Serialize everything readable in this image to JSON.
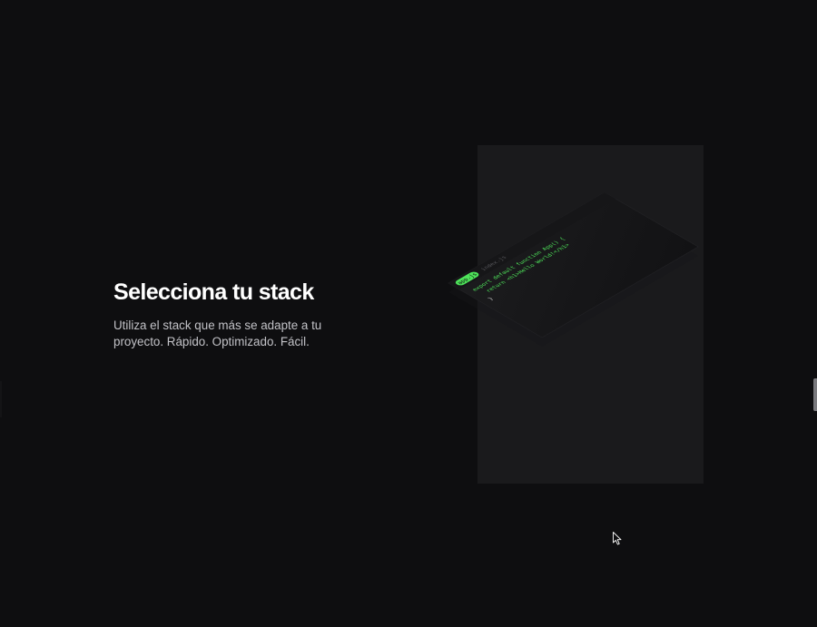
{
  "section": {
    "title": "Selecciona tu stack",
    "description": "Utiliza el stack que más se adapte a tu proyecto. Rápido. Optimizado. Fácil."
  },
  "code_card": {
    "active_tab": "app.js",
    "inactive_tab": "index.js",
    "lines": [
      "export default function App() {",
      "  return <h1>Hello World!</h1>",
      "}"
    ],
    "accent_color": "#4ee35a"
  },
  "icons": {
    "cursor": "arrow-cursor-icon"
  }
}
